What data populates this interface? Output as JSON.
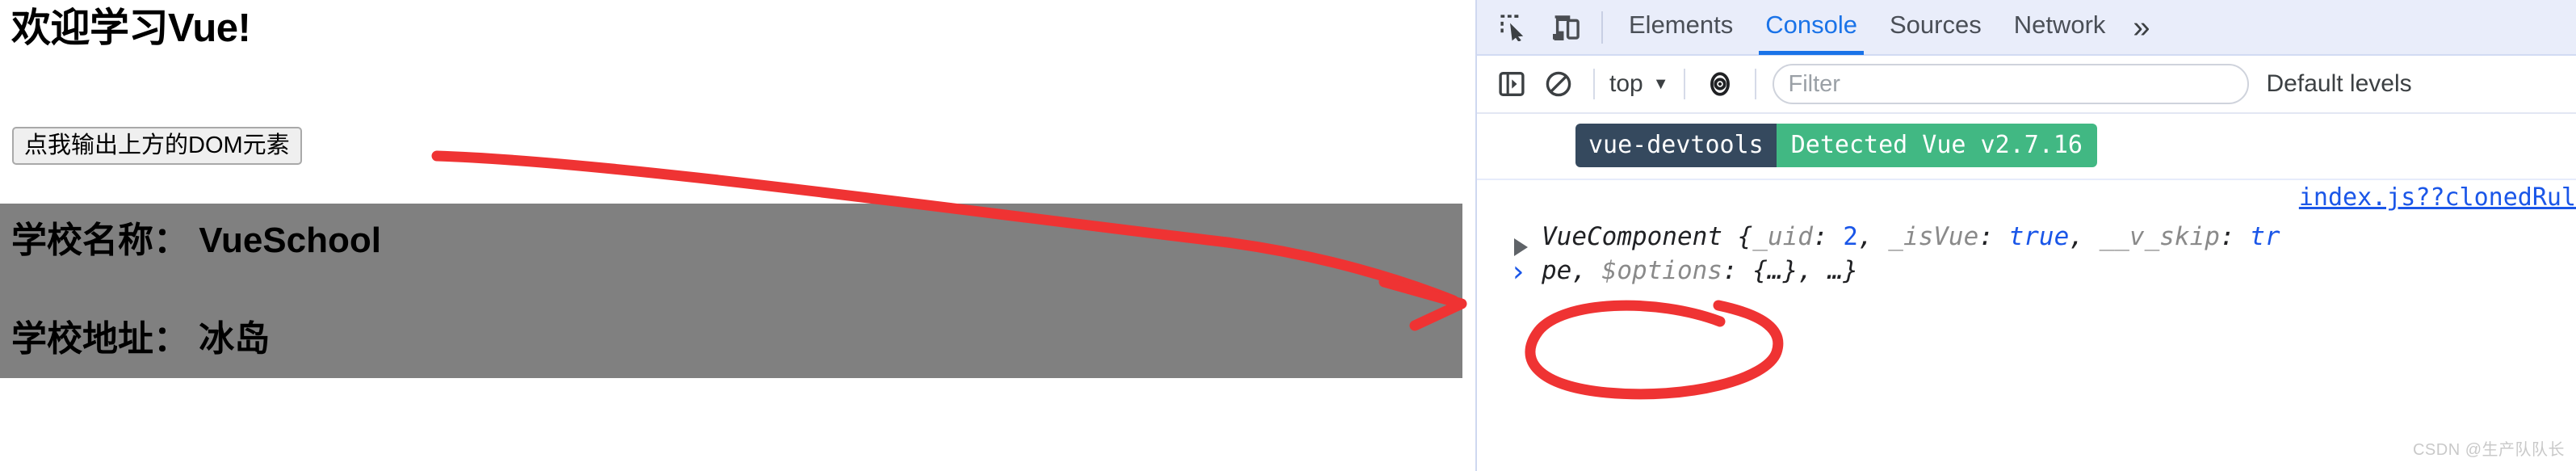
{
  "page": {
    "title": "欢迎学习Vue!",
    "button_label": "点我输出上方的DOM元素",
    "school": {
      "name_line": "学校名称： VueSchool",
      "address_line": "学校地址： 冰岛",
      "box_color": "#808080"
    }
  },
  "devtools": {
    "icons": {
      "inspect": "inspect-element-icon",
      "device": "device-toolbar-icon",
      "sidebar": "console-sidebar-icon",
      "clear": "clear-console-icon",
      "eye": "live-expression-icon"
    },
    "tabs": [
      {
        "label": "Elements",
        "active": false
      },
      {
        "label": "Console",
        "active": true
      },
      {
        "label": "Sources",
        "active": false
      },
      {
        "label": "Network",
        "active": false
      }
    ],
    "overflow_label": "»",
    "toolbar": {
      "context_label": "top",
      "context_caret": "▼",
      "filter_placeholder": "Filter",
      "filter_value": "",
      "levels_label": "Default levels"
    },
    "console": {
      "messages": [
        {
          "type": "vue-devtools-badge",
          "badge_left": "vue-devtools",
          "badge_right": "Detected Vue v2.7.16",
          "badge_left_color": "#35495e",
          "badge_right_color": "#41b883"
        },
        {
          "type": "object",
          "source_link": "index.js??clonedRul",
          "constructor": "VueComponent",
          "preview_line1_open": " {",
          "entries_line1": [
            {
              "key": "_uid",
              "sep": ": ",
              "value": "2",
              "value_kind": "number"
            },
            {
              "key": "_isVue",
              "sep": ": ",
              "value": "true",
              "value_kind": "boolean"
            },
            {
              "key": "__v_skip",
              "sep": ": ",
              "value": "tr",
              "value_kind": "boolean"
            }
          ],
          "line2": "pe, $options: {…}, …}",
          "line2_key": "$options",
          "line2_prefix": "pe, ",
          "line2_suffix": ": {…}, …}"
        }
      ],
      "prompt_symbol": "›"
    }
  },
  "annotation": {
    "color": "#ef3333",
    "description": "red-arrow-pointing-to-VueComponent"
  },
  "watermark": "CSDN @生产队队长"
}
